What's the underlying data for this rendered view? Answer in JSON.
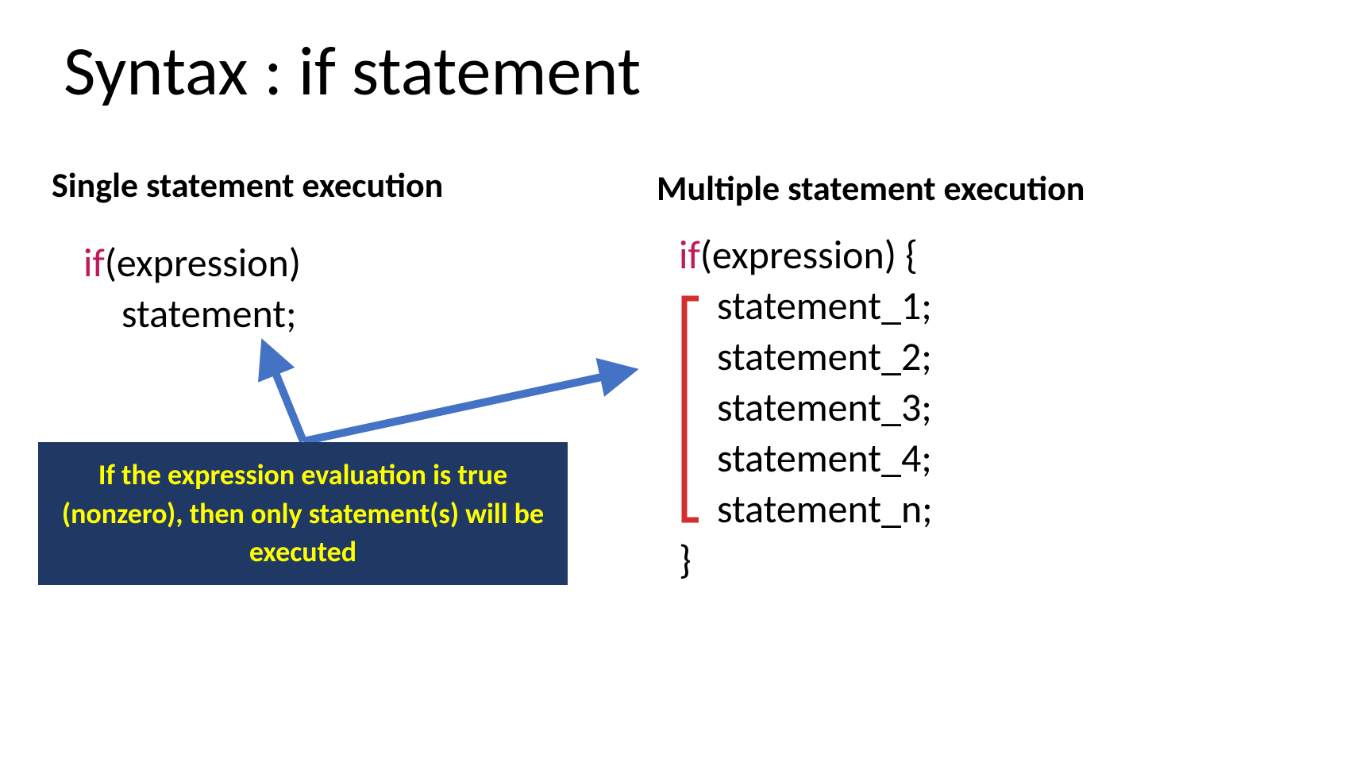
{
  "title": "Syntax : if statement",
  "left": {
    "heading": "Single statement execution",
    "if_keyword": "if",
    "expression": "(expression)",
    "statement": "statement;"
  },
  "right": {
    "heading": "Multiple statement execution",
    "if_keyword": "if",
    "expression": "(expression) {",
    "statements": [
      "statement_1;",
      "statement_2;",
      "statement_3;",
      "statement_4;",
      "statement_n;"
    ],
    "close_brace": "}"
  },
  "callout": "If the expression evaluation is true (nonzero), then only statement(s) will be executed"
}
